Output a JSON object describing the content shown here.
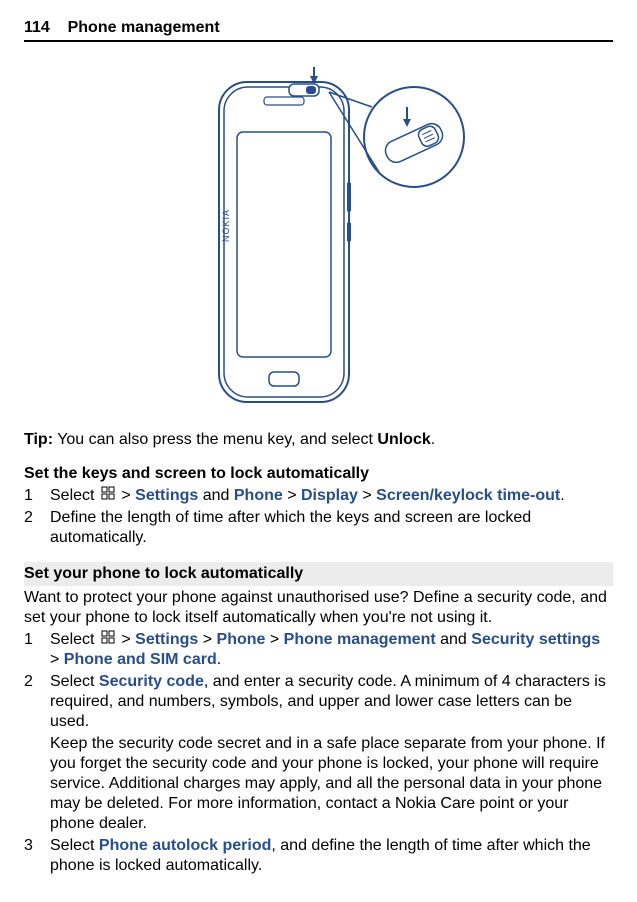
{
  "header": {
    "page_number": "114",
    "title": "Phone management"
  },
  "tip": {
    "prefix": "Tip:",
    "text_a": "You can also press the menu key, and select ",
    "unlock": "Unlock",
    "text_b": "."
  },
  "set_keys": {
    "title": "Set the keys and screen to lock automatically",
    "step1": {
      "num": "1",
      "a": "Select ",
      "sep1": " > ",
      "settings": "Settings",
      "and": " and ",
      "phone": "Phone",
      "sep2": "  > ",
      "display": "Display",
      "sep3": "  > ",
      "timeout": "Screen/keylock time-out",
      "period": "."
    },
    "step2": {
      "num": "2",
      "text": "Define the length of time after which the keys and screen are locked automatically."
    }
  },
  "autolock": {
    "title": "Set your phone to lock automatically",
    "intro": "Want to protect your phone against unauthorised use? Define a security code, and set your phone to lock itself automatically when you're not using it.",
    "step1": {
      "num": "1",
      "a": "Select ",
      "sep1": " > ",
      "settings": "Settings",
      "sep2": "  > ",
      "phone": "Phone",
      "sep3": "  > ",
      "phonemgmt": "Phone management",
      "and": " and ",
      "secsettings": "Security settings",
      "sep4": "  > ",
      "phonesim": "Phone and SIM card",
      "period": "."
    },
    "step2": {
      "num": "2",
      "a": "Select ",
      "seccode": "Security code",
      "b": ", and enter a security code. A minimum of 4 characters is required, and numbers, symbols, and upper and lower case letters can be used.",
      "c": "Keep the security code secret and in a safe place separate from your phone. If you forget the security code and your phone is locked, your phone will require service. Additional charges may apply, and all the personal data in your phone may be deleted. For more information, contact a Nokia Care point or your phone dealer."
    },
    "step3": {
      "num": "3",
      "a": "Select ",
      "autolock": "Phone autolock period",
      "b": ", and define the length of time after which the phone is locked automatically."
    }
  }
}
